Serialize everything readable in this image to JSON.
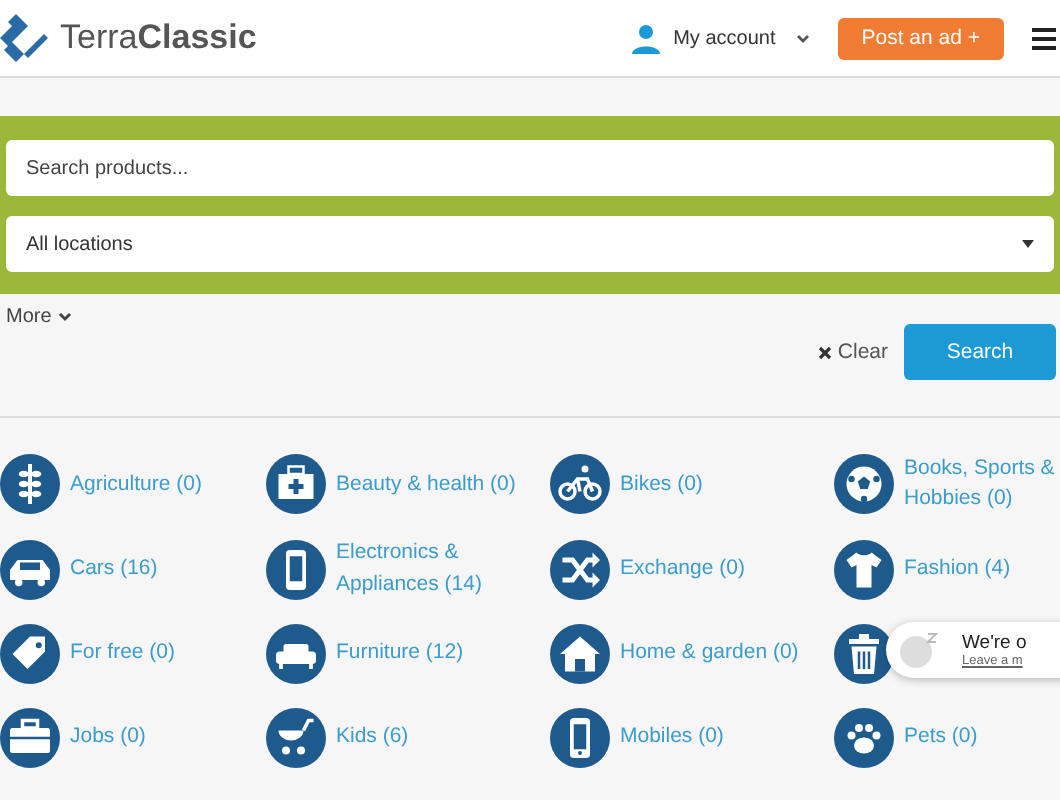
{
  "header": {
    "logo": "Terra**Classic**",
    "account": "My account",
    "post_button": "Post an ad +"
  },
  "search": {
    "placeholder": "Search products...",
    "location": "All locations",
    "more": "More",
    "clear": "Clear",
    "submit": "Search"
  },
  "categories": [
    {
      "label": "Agriculture (0)"
    },
    {
      "label": "Beauty & health (0)"
    },
    {
      "label": "Bikes (0)"
    },
    {
      "label": "Books, Sports & Hobbies (0)"
    },
    {
      "label": "Cars (16)"
    },
    {
      "label": "Electronics & Appliances (14)"
    },
    {
      "label": "Exchange (0)"
    },
    {
      "label": "Fashion (4)"
    },
    {
      "label": "For free (0)"
    },
    {
      "label": "Furniture (12)"
    },
    {
      "label": "Home & garden (0)"
    },
    {
      "kind": "icon_only"
    },
    {
      "label": "Jobs (0)"
    },
    {
      "label": "Kids (6)"
    },
    {
      "label": "Mobiles (0)"
    },
    {
      "label": "Pets (0)"
    }
  ],
  "chat": {
    "title": "We're o",
    "link": "Leave a m"
  }
}
